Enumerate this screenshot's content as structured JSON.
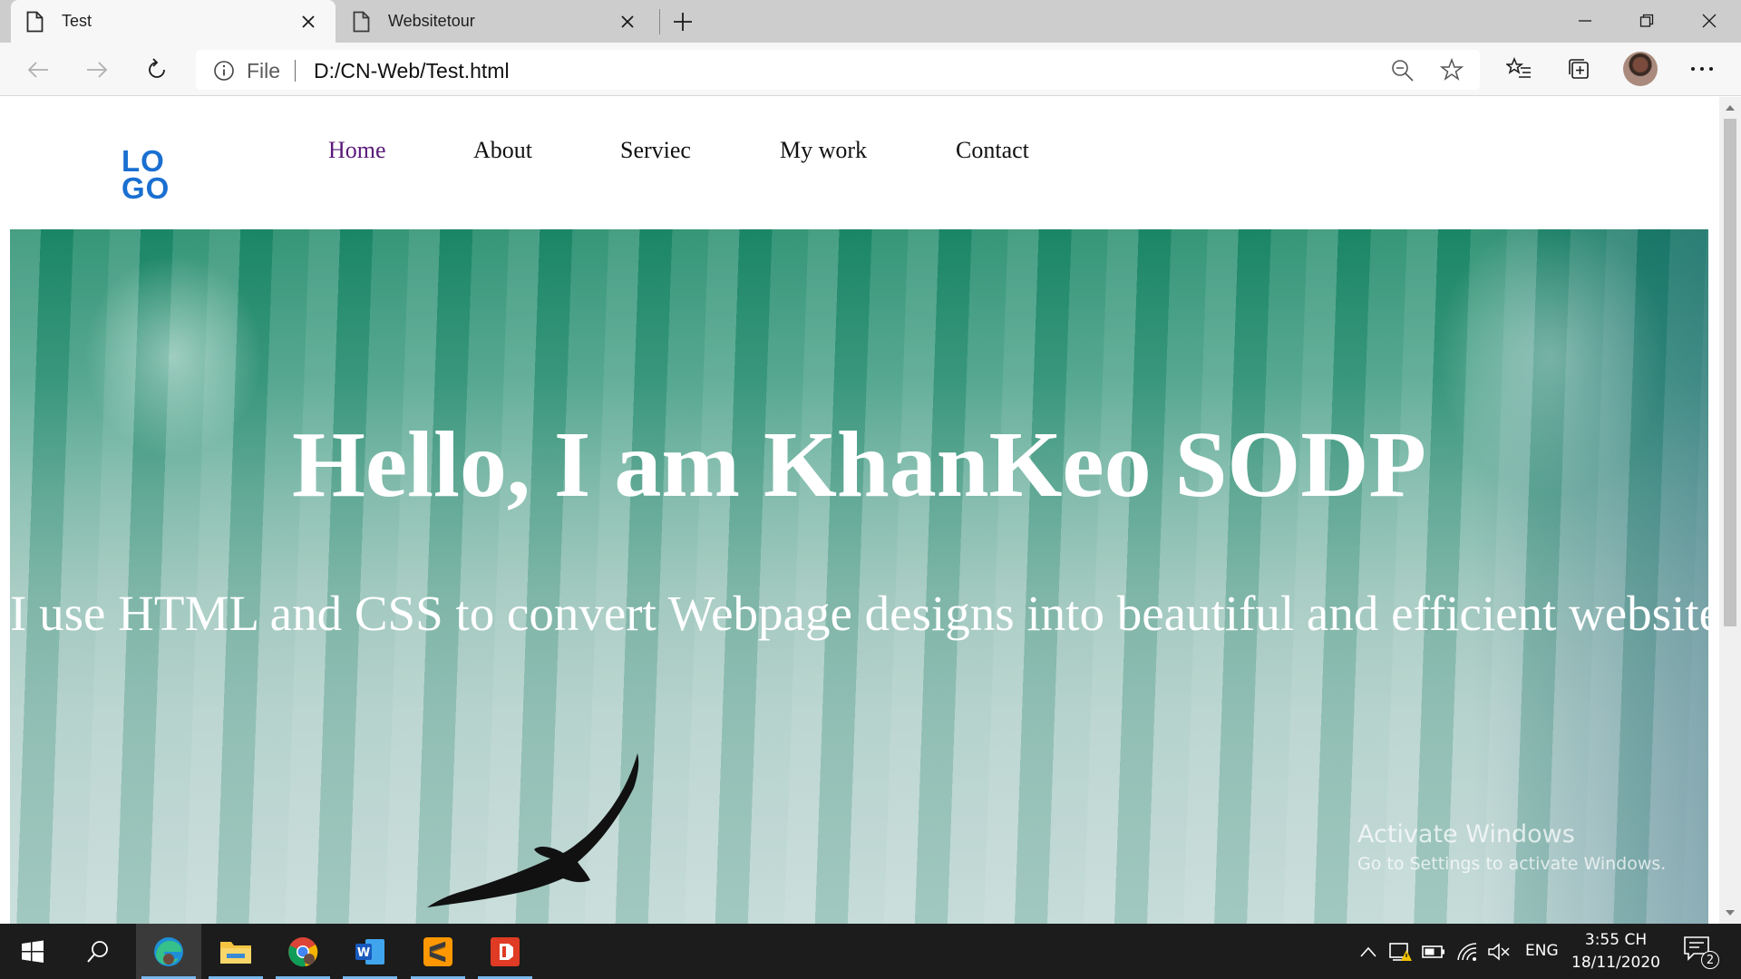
{
  "browser": {
    "tabs": [
      {
        "title": "Test",
        "active": true
      },
      {
        "title": "Websitetour",
        "active": false
      }
    ],
    "address": {
      "scheme_label": "File",
      "url": "D:/CN-Web/Test.html"
    }
  },
  "page": {
    "logo": {
      "line1": "LO",
      "line2": "GO",
      "color": "#1a6fd1"
    },
    "nav": [
      {
        "label": "Home",
        "active": true
      },
      {
        "label": "About",
        "active": false
      },
      {
        "label": "Serviec",
        "active": false
      },
      {
        "label": "My work",
        "active": false
      },
      {
        "label": "Contact",
        "active": false
      }
    ],
    "hero": {
      "title": "Hello, I am KhanKeo SODP",
      "subtitle": "I use HTML and CSS to convert Webpage designs into beautiful and efficient website."
    },
    "watermark": {
      "title": "Activate Windows",
      "subtitle": "Go to Settings to activate Windows."
    }
  },
  "taskbar": {
    "apps": [
      "start-icon",
      "search-icon",
      "edge-icon",
      "file-explorer-icon",
      "chrome-icon",
      "word-icon",
      "sublime-text-icon",
      "office-icon"
    ],
    "language": "ENG",
    "time": "3:55 CH",
    "date": "18/11/2020",
    "notification_count": "2"
  }
}
